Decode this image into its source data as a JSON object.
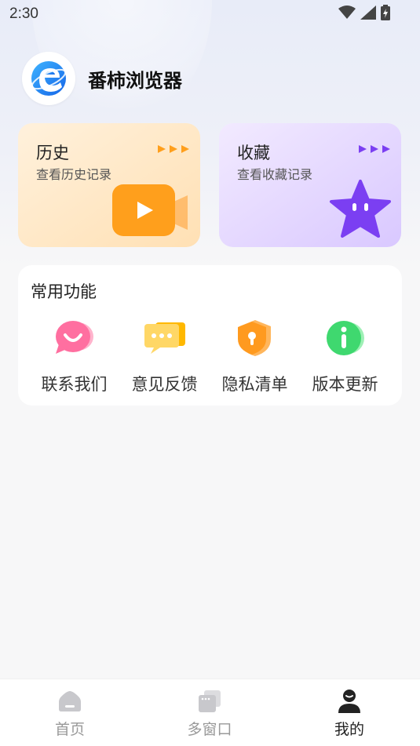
{
  "status_bar": {
    "time": "2:30"
  },
  "profile": {
    "app_name": "番柿浏览器"
  },
  "cards": {
    "history": {
      "title": "历史",
      "subtitle": "查看历史记录"
    },
    "favorites": {
      "title": "收藏",
      "subtitle": "查看收藏记录"
    }
  },
  "functions": {
    "title": "常用功能",
    "items": [
      {
        "label": "联系我们",
        "icon": "chat-bubble-icon"
      },
      {
        "label": "意见反馈",
        "icon": "feedback-message-icon"
      },
      {
        "label": "隐私清单",
        "icon": "privacy-shield-icon"
      },
      {
        "label": "版本更新",
        "icon": "info-icon"
      }
    ]
  },
  "tab_bar": {
    "tabs": [
      {
        "label": "首页",
        "icon": "home-icon",
        "active": false
      },
      {
        "label": "多窗口",
        "icon": "windows-icon",
        "active": false
      },
      {
        "label": "我的",
        "icon": "profile-icon",
        "active": true
      }
    ]
  },
  "colors": {
    "history_accent": "#ff9f1c",
    "favorites_accent": "#7b3ff2",
    "contact_pink": "#ff6fa0",
    "feedback_yellow": "#ffc43a",
    "privacy_orange": "#ff9a1f",
    "update_green": "#3fd86f"
  }
}
